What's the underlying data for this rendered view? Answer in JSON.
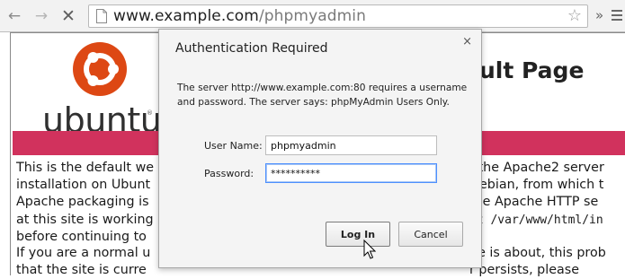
{
  "browser": {
    "url_host": "www.example.com",
    "url_path": "/phpmyadmin",
    "icons": [
      "back-arrow-icon",
      "forward-arrow-icon",
      "stop-icon",
      "page-icon",
      "star-icon",
      "overflow-chevron-icon",
      "menu-icon"
    ],
    "overflow_label": "»"
  },
  "page": {
    "logo_text": "ubuntu",
    "logo_mark": "®",
    "logo_color": "#dd4814",
    "heading": "ult Page",
    "band_color": "#d1325d",
    "para1_left": [
      "This is the default we",
      "installation on Ubunt",
      "Apache packaging is",
      "at this site is working",
      "before continuing to"
    ],
    "para1_right": [
      "f the Apache2 server",
      "Debian, from which t",
      "the Apache HTTP se",
      "at /var/www/html/in",
      ""
    ],
    "para2_left": [
      "If you are a normal u",
      "that the site is curre"
    ],
    "para2_right": [
      "ge is about, this prob",
      "r persists, please"
    ]
  },
  "dialog": {
    "title": "Authentication Required",
    "close_label": "×",
    "message": "The server http://www.example.com:80 requires a username and password. The server says: phpMyAdmin Users Only.",
    "username_label": "User Name:",
    "username_value": "phpmyadmin",
    "password_label": "Password:",
    "password_value": "**********",
    "login_label": "Log In",
    "cancel_label": "Cancel"
  }
}
